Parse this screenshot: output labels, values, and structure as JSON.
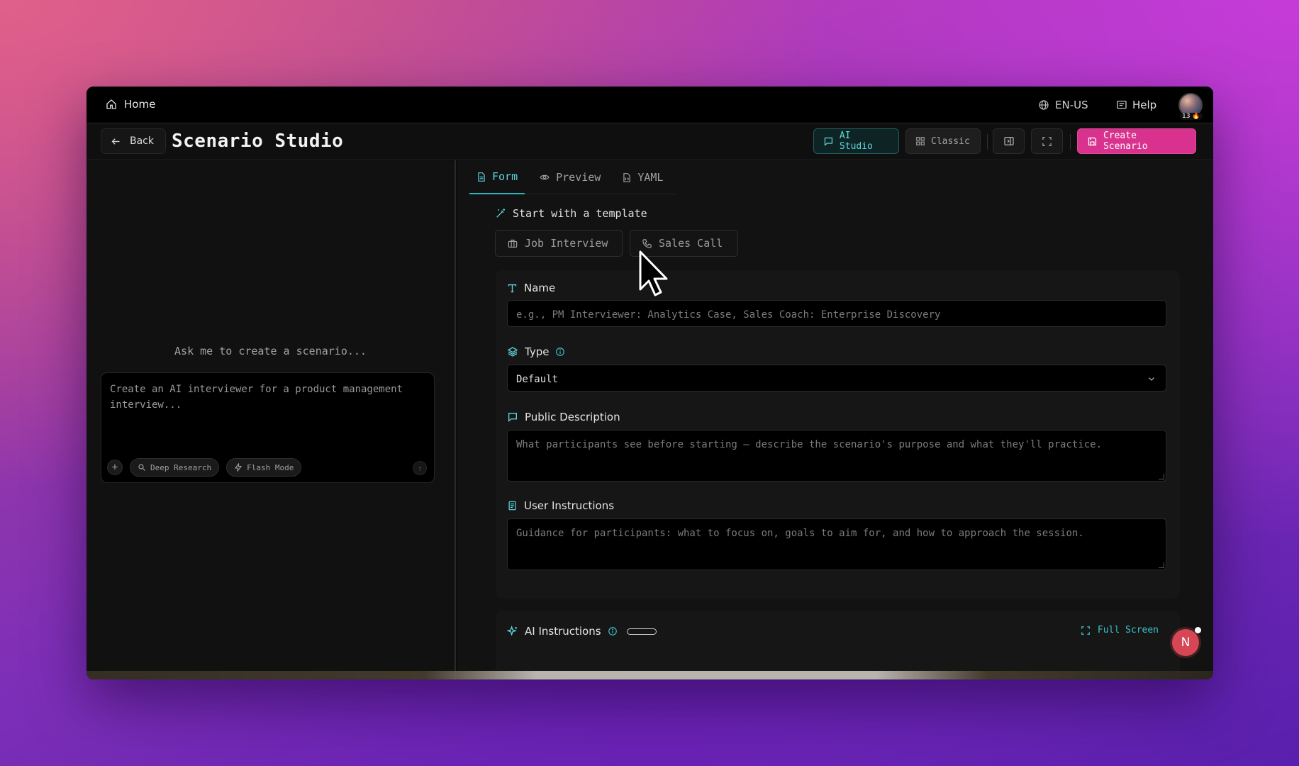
{
  "topbar": {
    "home_label": "Home",
    "language": "EN-US",
    "help_label": "Help",
    "avatar_badge": "13 🔥"
  },
  "header": {
    "back_label": "Back",
    "title": "Scenario Studio",
    "ai_studio_label": "AI Studio",
    "classic_label": "Classic",
    "create_label": "Create Scenario"
  },
  "chat": {
    "prompt": "Ask me to create a scenario...",
    "placeholder": "Create an AI interviewer for a product management interview...",
    "deep_research_label": "Deep Research",
    "flash_mode_label": "Flash Mode"
  },
  "tabs": [
    {
      "label": "Form",
      "active": true
    },
    {
      "label": "Preview",
      "active": false
    },
    {
      "label": "YAML",
      "active": false
    }
  ],
  "templates": {
    "heading": "Start with a template",
    "items": [
      "Job Interview",
      "Sales Call"
    ]
  },
  "form": {
    "name_label": "Name",
    "name_placeholder": "e.g., PM Interviewer: Analytics Case, Sales Coach: Enterprise Discovery",
    "type_label": "Type",
    "type_value": "Default",
    "public_desc_label": "Public Description",
    "public_desc_placeholder": "What participants see before starting — describe the scenario's purpose and what they'll practice.",
    "user_instr_label": "User Instructions",
    "user_instr_placeholder": "Guidance for participants: what to focus on, goals to aim for, and how to approach the session.",
    "ai_instr_label": "AI Instructions",
    "full_screen_label": "Full Screen"
  },
  "notification": {
    "initial": "N"
  },
  "colors": {
    "accent": "#5ed6dc",
    "create": "#d9328e",
    "notif": "#d74654"
  }
}
